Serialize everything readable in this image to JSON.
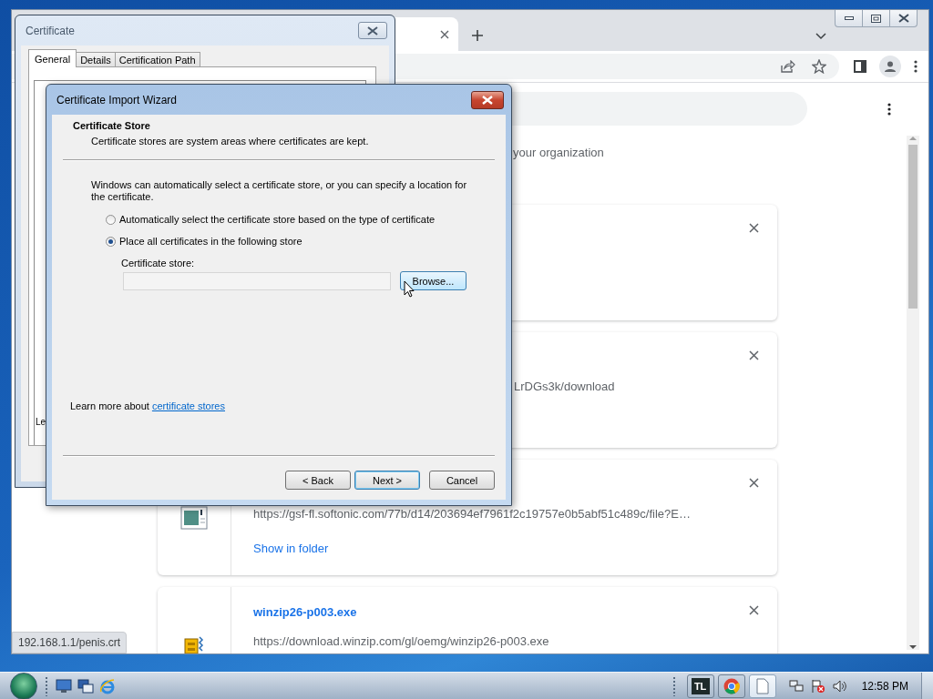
{
  "browser": {
    "page": {
      "notice_fragment": "your organization",
      "downloads": [
        {
          "kind": "partly_covered"
        },
        {
          "kind": "partly_covered",
          "url": "LrDGs3k/download"
        },
        {
          "kind": "image_file",
          "url": "https://gsf-fl.softonic.com/77b/d14/203694ef7961f2c19757e0b5abf51c489c/file?E…",
          "link": "Show in folder"
        },
        {
          "kind": "installer",
          "name": "winzip26-p003.exe",
          "url": "https://download.winzip.com/gl/oemg/winzip26-p003.exe"
        }
      ]
    },
    "status_bubble": "192.168.1.1/penis.crt"
  },
  "certificate_dialog": {
    "title": "Certificate",
    "tabs": [
      {
        "label": "General",
        "selected": true
      },
      {
        "label": "Details",
        "selected": false
      },
      {
        "label": "Certification Path",
        "selected": false
      }
    ],
    "text_fragment": "Le"
  },
  "wizard": {
    "title": "Certificate Import Wizard",
    "heading": "Certificate Store",
    "subheading": "Certificate stores are system areas where certificates are kept.",
    "intro": "Windows can automatically select a certificate store, or you can specify a location for the certificate.",
    "options": [
      {
        "label": "Automatically select the certificate store based on the type of certificate",
        "selected": false
      },
      {
        "label": "Place all certificates in the following store",
        "selected": true
      }
    ],
    "store_label": "Certificate store:",
    "browse_button": {
      "label": "Browse...",
      "hovered": true
    },
    "learn_more": {
      "text": "Learn more about",
      "link": "certificate stores"
    },
    "buttons": [
      {
        "label": "< Back",
        "default": false
      },
      {
        "label": "Next >",
        "default": true
      },
      {
        "label": "Cancel",
        "default": false
      }
    ]
  },
  "taskbar": {
    "apps": [
      {
        "kind": "text",
        "label": "TL",
        "active": false
      },
      {
        "kind": "chrome",
        "active": false
      },
      {
        "kind": "document",
        "active": true
      }
    ],
    "clock": "12:58 PM"
  }
}
